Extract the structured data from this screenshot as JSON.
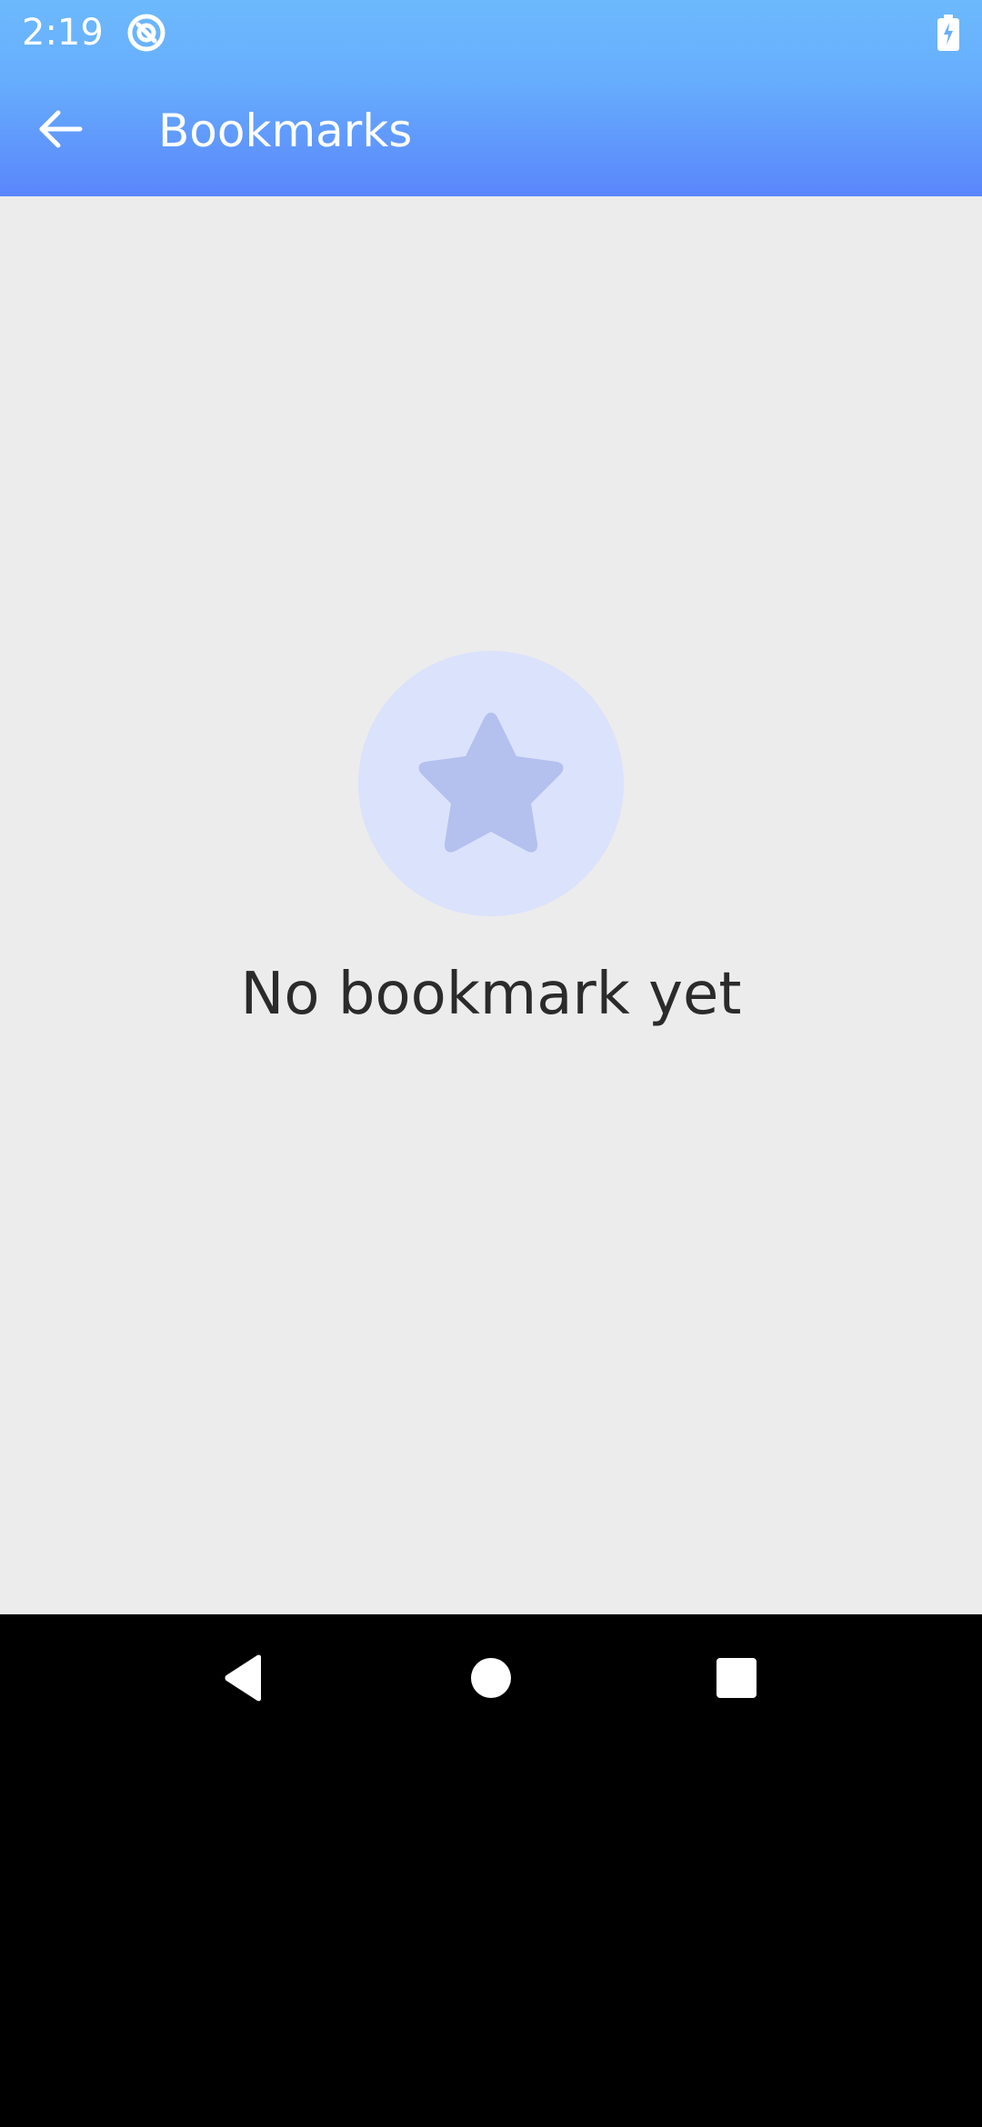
{
  "status_bar": {
    "time": "2:19",
    "app_icon": "sync-circle-icon",
    "battery_icon": "battery-charging-icon"
  },
  "toolbar": {
    "back_icon": "arrow-back-icon",
    "title": "Bookmarks"
  },
  "empty_state": {
    "icon": "star-icon",
    "message": "No bookmark yet"
  },
  "nav_bar": {
    "back_icon": "nav-back-triangle-icon",
    "home_icon": "nav-home-circle-icon",
    "recents_icon": "nav-recents-square-icon"
  },
  "colors": {
    "header_top": "#6cb9fd",
    "header_bottom": "#5a86fc",
    "content_bg": "#ececec",
    "illustration_circle": "#dbe2fc",
    "star_fill": "#b4c0ee",
    "message_text": "#2b2b2b"
  }
}
